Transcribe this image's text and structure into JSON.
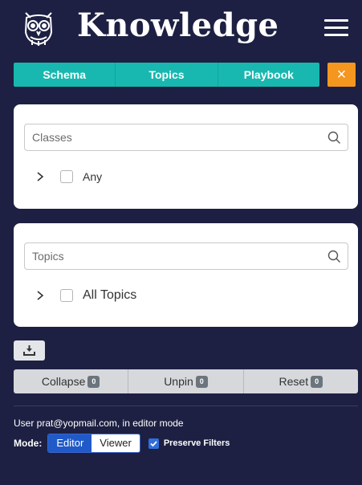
{
  "header": {
    "title": "Knowledge",
    "logo_icon": "owl-logo-icon",
    "menu_icon": "hamburger-menu-icon"
  },
  "tabs": [
    {
      "label": "Schema"
    },
    {
      "label": "Topics"
    },
    {
      "label": "Playbook"
    }
  ],
  "close_button": {
    "label": "×",
    "icon": "close-icon"
  },
  "classes_panel": {
    "search_placeholder": "Classes",
    "tree_items": [
      {
        "label": "Any",
        "checked": false,
        "expanded": false
      }
    ]
  },
  "topics_panel": {
    "search_placeholder": "Topics",
    "tree_items": [
      {
        "label": "All Topics",
        "checked": false,
        "expanded": false
      }
    ]
  },
  "download_icon": "download-icon",
  "actions": [
    {
      "label": "Collapse",
      "count": "0"
    },
    {
      "label": "Unpin",
      "count": "0"
    },
    {
      "label": "Reset",
      "count": "0"
    }
  ],
  "footer": {
    "user_text": "User prat@yopmail.com, in editor mode",
    "mode_label": "Mode:",
    "modes": [
      {
        "label": "Editor",
        "active": true
      },
      {
        "label": "Viewer",
        "active": false
      }
    ],
    "preserve_filters": {
      "label": "Preserve Filters",
      "checked": true
    }
  },
  "colors": {
    "background": "#1d2042",
    "tab_teal": "#18b8b0",
    "close_orange": "#f5961f",
    "editor_blue": "#1f5ac8"
  }
}
